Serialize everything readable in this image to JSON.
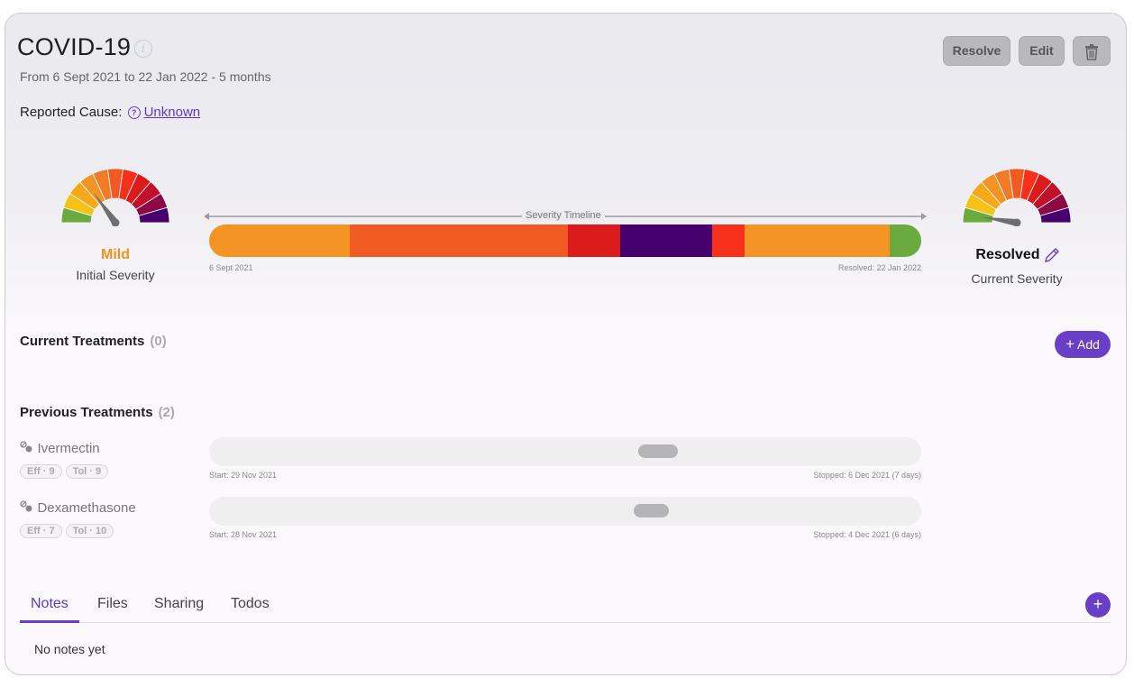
{
  "header": {
    "title": "COVID-19",
    "info_icon": "i",
    "date_range": "From 6 Sept 2021 to 22 Jan 2022 - 5 months",
    "reported_cause_label": "Reported Cause:",
    "reported_cause_value": "Unknown",
    "reported_cause_icon": "?"
  },
  "actions": {
    "resolve_label": "Resolve",
    "edit_label": "Edit",
    "delete_icon": "trash-icon"
  },
  "initial_severity": {
    "label": "Mild",
    "caption": "Initial Severity",
    "label_color": "#f0931e",
    "gauge_value_fraction": 0.3
  },
  "current_severity": {
    "label": "Resolved",
    "caption": "Current Severity",
    "label_color": "#111111",
    "gauge_value_fraction": 0.05
  },
  "timeline": {
    "title": "Severity Timeline",
    "start_label": "6 Sept 2021",
    "end_label": "Resolved: 22 Jan 2022",
    "segments": [
      {
        "color": "#f39424",
        "fraction": 0.198
      },
      {
        "color": "#f15a22",
        "fraction": 0.306
      },
      {
        "color": "#dc1c1c",
        "fraction": 0.073
      },
      {
        "color": "#45006e",
        "fraction": 0.13
      },
      {
        "color": "#f7301b",
        "fraction": 0.045
      },
      {
        "color": "#f39424",
        "fraction": 0.204
      },
      {
        "color": "#6aaa3f",
        "fraction": 0.044
      }
    ]
  },
  "gauge_colors": [
    "#6aaa3f",
    "#f6c118",
    "#f6a818",
    "#f39424",
    "#f07b29",
    "#f15a22",
    "#f7301b",
    "#dc1c1c",
    "#c0102a",
    "#8b0a45",
    "#45006e"
  ],
  "current_treatments": {
    "title": "Current Treatments",
    "count": "(0)",
    "add_label": "Add",
    "add_icon": "+"
  },
  "previous_treatments": {
    "title": "Previous Treatments",
    "count": "(2)",
    "items": [
      {
        "name": "Ivermectin",
        "eff": "Eff · 9",
        "tol": "Tol · 9",
        "start": "Start: 29 Nov 2021",
        "stop": "Stopped: 6 Dec 2021 (7 days)",
        "pill_start": 0.603,
        "pill_end": 0.658
      },
      {
        "name": "Dexamethasone",
        "eff": "Eff · 7",
        "tol": "Tol · 10",
        "start": "Start: 28 Nov 2021",
        "stop": "Stopped: 4 Dec 2021 (6 days)",
        "pill_start": 0.596,
        "pill_end": 0.646
      }
    ]
  },
  "tabs": {
    "items": [
      "Notes",
      "Files",
      "Sharing",
      "Todos"
    ],
    "active": "Notes",
    "add_icon": "+"
  },
  "notes": {
    "empty_text": "No notes yet"
  }
}
